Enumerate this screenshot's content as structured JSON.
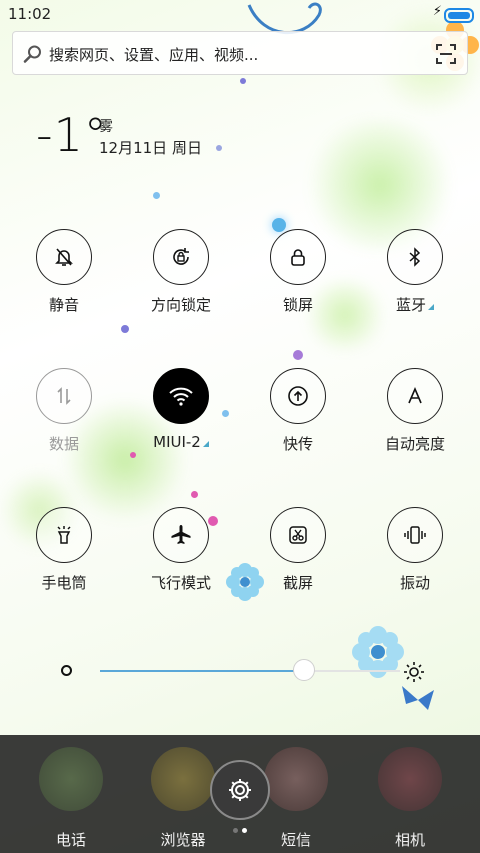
{
  "status_bar": {
    "time": "11:02",
    "charging": "⚡"
  },
  "search": {
    "placeholder": "搜索网页、设置、应用、视频..."
  },
  "weather": {
    "temperature": "-1°",
    "condition": "雾",
    "date": "12月11日 周日"
  },
  "toggles": [
    {
      "label": "静音",
      "icon": "bell-off-icon",
      "state": "off"
    },
    {
      "label": "方向锁定",
      "icon": "rotation-lock-icon",
      "state": "off"
    },
    {
      "label": "锁屏",
      "icon": "lock-icon",
      "state": "off"
    },
    {
      "label": "蓝牙",
      "icon": "bluetooth-icon",
      "state": "off",
      "has_more": true
    },
    {
      "label": "数据",
      "icon": "mobile-data-icon",
      "state": "disabled"
    },
    {
      "label": "MIUI-2",
      "icon": "wifi-icon",
      "state": "on",
      "has_more": true
    },
    {
      "label": "快传",
      "icon": "quick-transfer-icon",
      "state": "off"
    },
    {
      "label": "自动亮度",
      "icon": "auto-brightness-icon",
      "state": "off"
    },
    {
      "label": "手电筒",
      "icon": "flashlight-icon",
      "state": "off"
    },
    {
      "label": "飞行模式",
      "icon": "airplane-icon",
      "state": "off"
    },
    {
      "label": "截屏",
      "icon": "screenshot-icon",
      "state": "off"
    },
    {
      "label": "振动",
      "icon": "vibrate-icon",
      "state": "off"
    }
  ],
  "brightness": {
    "level_percent": 68
  },
  "dock": {
    "apps": [
      {
        "name": "电话"
      },
      {
        "name": "浏览器"
      },
      {
        "name": "短信"
      },
      {
        "name": "相机"
      }
    ],
    "page_count": 2,
    "current_page": 2
  },
  "colors": {
    "accent": "#5aa7d8",
    "active_toggle": "#000000",
    "dock_bg": "#202020"
  }
}
